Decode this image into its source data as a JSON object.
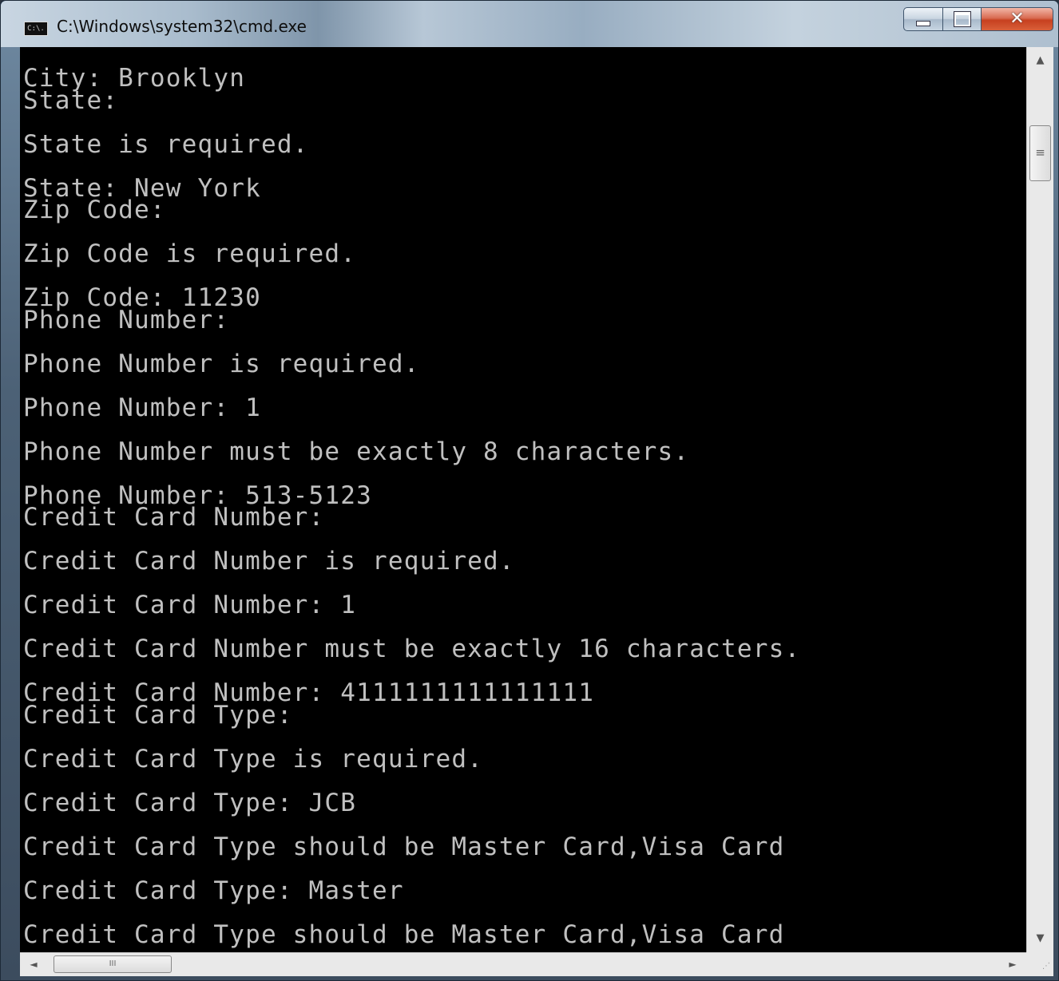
{
  "window": {
    "title": "C:\\Windows\\system32\\cmd.exe",
    "app_icon_text": "C:\\."
  },
  "console": {
    "lines": [
      "City: Brooklyn",
      "State:",
      "",
      "State is required.",
      "",
      "State: New York",
      "Zip Code:",
      "",
      "Zip Code is required.",
      "",
      "Zip Code: 11230",
      "Phone Number:",
      "",
      "Phone Number is required.",
      "",
      "Phone Number: 1",
      "",
      "Phone Number must be exactly 8 characters.",
      "",
      "Phone Number: 513-5123",
      "Credit Card Number:",
      "",
      "Credit Card Number is required.",
      "",
      "Credit Card Number: 1",
      "",
      "Credit Card Number must be exactly 16 characters.",
      "",
      "Credit Card Number: 4111111111111111",
      "Credit Card Type:",
      "",
      "Credit Card Type is required.",
      "",
      "Credit Card Type: JCB",
      "",
      "Credit Card Type should be Master Card,Visa Card",
      "",
      "Credit Card Type: Master",
      "",
      "Credit Card Type should be Master Card,Visa Card"
    ]
  },
  "scrollbars": {
    "vertical_thumb_glyph": "≡",
    "horizontal_thumb_glyph": "III",
    "up_arrow": "▲",
    "down_arrow": "▼",
    "left_arrow": "◄",
    "right_arrow": "►"
  },
  "icons": [
    "console-app-icon",
    "minimize-icon",
    "maximize-icon",
    "close-icon"
  ]
}
